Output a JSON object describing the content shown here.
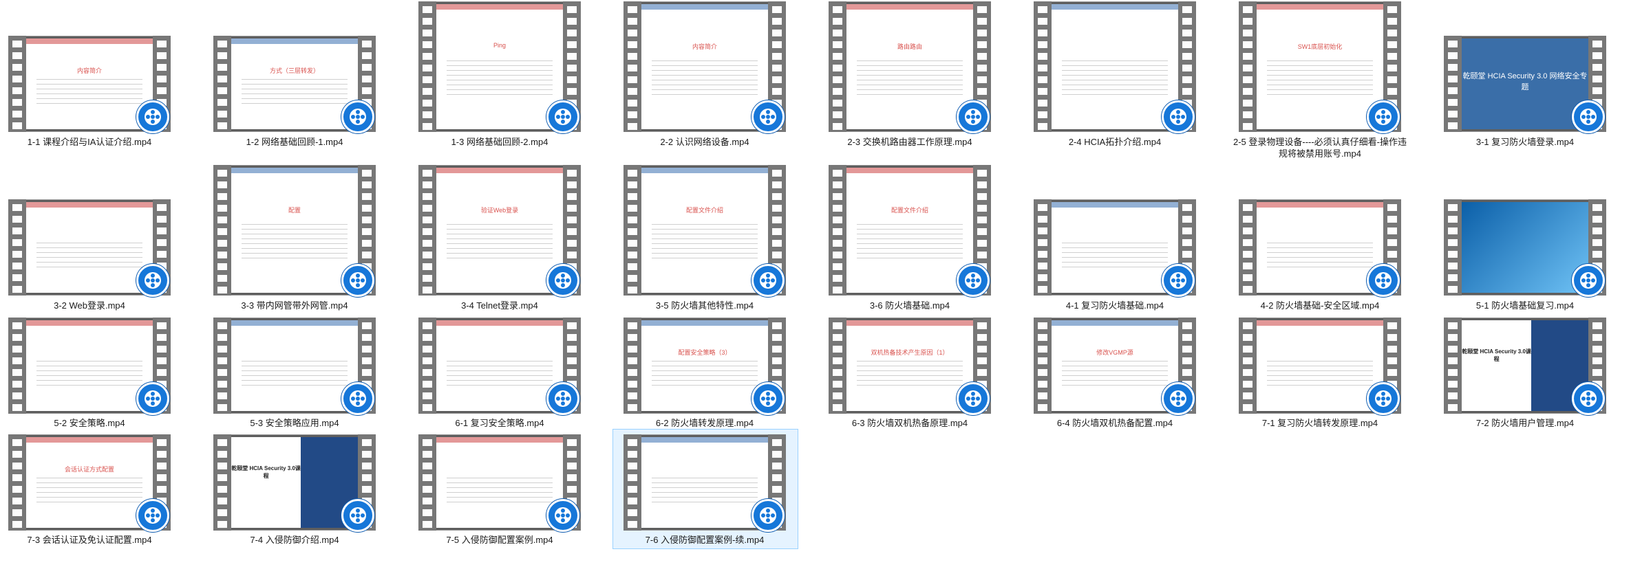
{
  "files": [
    {
      "name": "1-1 课程介绍与IA认证介绍.mp4",
      "thumb": {
        "title": "内容简介",
        "style": "white"
      }
    },
    {
      "name": "1-2 网络基础回顾-1.mp4",
      "thumb": {
        "title": "方式（三层转发）",
        "style": "white"
      }
    },
    {
      "name": "1-3 网络基础回顾-2.mp4",
      "thumb": {
        "title": "Ping",
        "style": "white"
      }
    },
    {
      "name": "2-2 认识网络设备.mp4",
      "thumb": {
        "title": "内容简介",
        "style": "white"
      }
    },
    {
      "name": "2-3 交换机路由器工作原理.mp4",
      "thumb": {
        "title": "路由路由",
        "style": "white"
      }
    },
    {
      "name": "2-4 HCIA拓扑介绍.mp4",
      "thumb": {
        "title": "",
        "style": "white"
      }
    },
    {
      "name": "2-5 登录物理设备----必须认真仔细看-操作违规将被禁用账号.mp4",
      "thumb": {
        "title": "SW1底层初始化",
        "style": "white"
      }
    },
    {
      "name": "3-1 复习防火墙登录.mp4",
      "thumb": {
        "title": "乾颐堂 HCIA Security 3.0 网络安全专题",
        "style": "blue"
      }
    },
    {
      "name": "3-2 Web登录.mp4",
      "thumb": {
        "title": "",
        "style": "white"
      }
    },
    {
      "name": "3-3 带内网管带外网管.mp4",
      "thumb": {
        "title": "配置",
        "style": "white"
      }
    },
    {
      "name": "3-4 Telnet登录.mp4",
      "thumb": {
        "title": "验证Web登录",
        "style": "white"
      }
    },
    {
      "name": "3-5 防火墙其他特性.mp4",
      "thumb": {
        "title": "配置文件介绍",
        "style": "white"
      }
    },
    {
      "name": "3-6 防火墙基础.mp4",
      "thumb": {
        "title": "配置文件介绍",
        "style": "white"
      }
    },
    {
      "name": "4-1 复习防火墙基础.mp4",
      "thumb": {
        "title": "",
        "style": "white"
      }
    },
    {
      "name": "4-2 防火墙基础-安全区域.mp4",
      "thumb": {
        "title": "",
        "style": "white"
      }
    },
    {
      "name": "5-1 防火墙基础复习.mp4",
      "thumb": {
        "title": "",
        "style": "win"
      }
    },
    {
      "name": "5-2 安全策略.mp4",
      "thumb": {
        "title": "",
        "style": "white"
      }
    },
    {
      "name": "5-3 安全策略应用.mp4",
      "thumb": {
        "title": "",
        "style": "white"
      }
    },
    {
      "name": "6-1 复习安全策略.mp4",
      "thumb": {
        "title": "",
        "style": "white"
      }
    },
    {
      "name": "6-2 防火墙转发原理.mp4",
      "thumb": {
        "title": "配置安全策略（3）",
        "style": "white"
      }
    },
    {
      "name": "6-3 防火墙双机热备原理.mp4",
      "thumb": {
        "title": "双机热备技术产生原因（1）",
        "style": "white"
      }
    },
    {
      "name": "6-4 防火墙双机热备配置.mp4",
      "thumb": {
        "title": "修改VGMP源",
        "style": "white"
      }
    },
    {
      "name": "7-1 复习防火墙转发原理.mp4",
      "thumb": {
        "title": "",
        "style": "white"
      }
    },
    {
      "name": "7-2 防火墙用户管理.mp4",
      "thumb": {
        "title": "乾颐堂 HCIA Security 3.0课程",
        "style": "split"
      }
    },
    {
      "name": "7-3 会话认证及免认证配置.mp4",
      "thumb": {
        "title": "会话认证方式配置",
        "style": "white"
      }
    },
    {
      "name": "7-4 入侵防御介绍.mp4",
      "thumb": {
        "title": "乾颐堂 HCIA Security 3.0课程",
        "style": "split"
      }
    },
    {
      "name": "7-5 入侵防御配置案例.mp4",
      "thumb": {
        "title": "",
        "style": "white"
      }
    },
    {
      "name": "7-6 入侵防御配置案例-续.mp4",
      "thumb": {
        "title": "",
        "style": "white"
      }
    }
  ],
  "icons": {
    "player": "video-player-badge-icon"
  },
  "colors": {
    "selection_bg": "#e5f3ff",
    "selection_border": "#99d1ff",
    "player_blue": "#1677d9",
    "film": "#5e5e5e"
  }
}
